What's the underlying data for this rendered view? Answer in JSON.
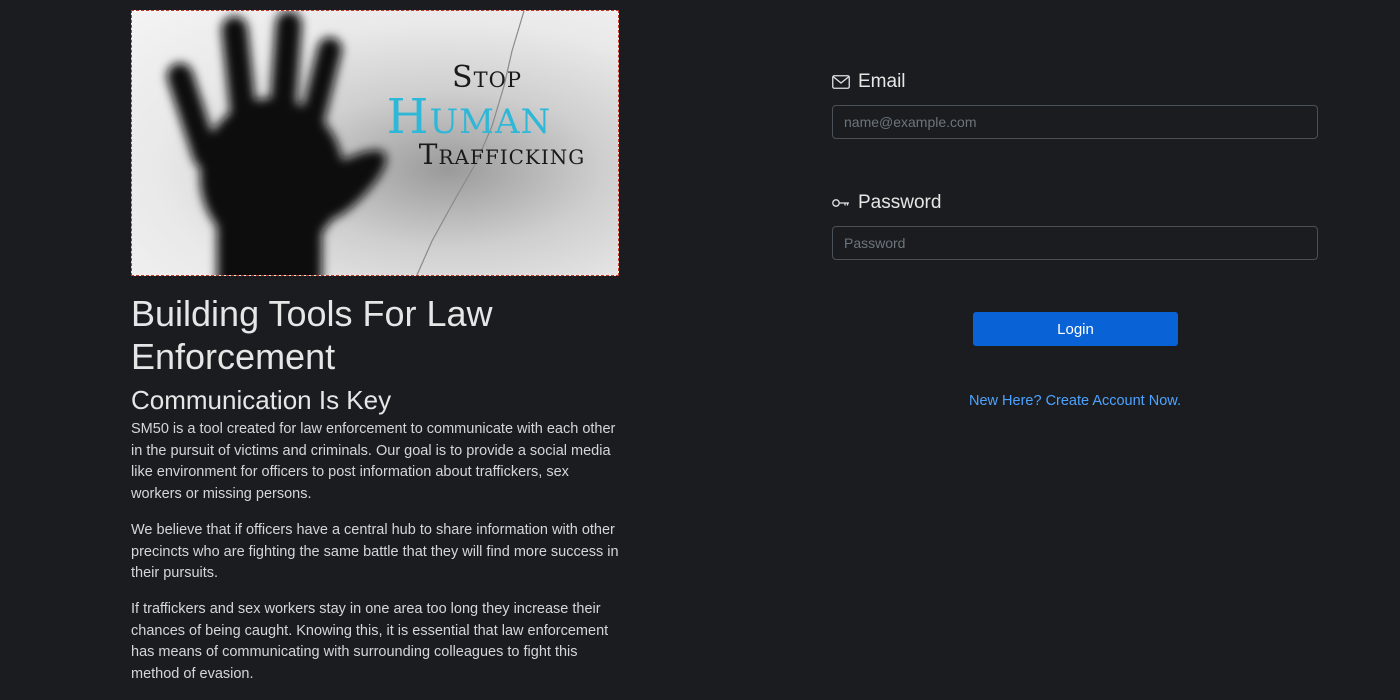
{
  "hero": {
    "line1": "Stop",
    "line2": "Human",
    "line3": "Trafficking"
  },
  "headings": {
    "main": "Building Tools For Law Enforcement",
    "sub": "Communication Is Key"
  },
  "paragraphs": [
    "SM50 is a tool created for law enforcement to communicate with each other in the pursuit of victims and criminals. Our goal is to provide a social media like environment for officers to post information about traffickers, sex workers or missing persons.",
    "We believe that if officers have a central hub to share information with other precincts who are fighting the same battle that they will find more success in their pursuits.",
    "If traffickers and sex workers stay in one area too long they increase their chances of being caught. Knowing this, it is essential that law enforcement has means of communicating with surrounding colleagues to fight this method of evasion."
  ],
  "form": {
    "email_label": "Email",
    "email_placeholder": "name@example.com",
    "email_icon": "envelope-icon",
    "password_label": "Password",
    "password_placeholder": "Password",
    "password_icon": "key-icon",
    "login_label": "Login",
    "create_account_link": "New Here? Create Account Now."
  },
  "colors": {
    "background": "#1b1c1f",
    "accent": "#0a63d6",
    "link": "#4da3ff",
    "hero_highlight": "#2fb7d8"
  }
}
